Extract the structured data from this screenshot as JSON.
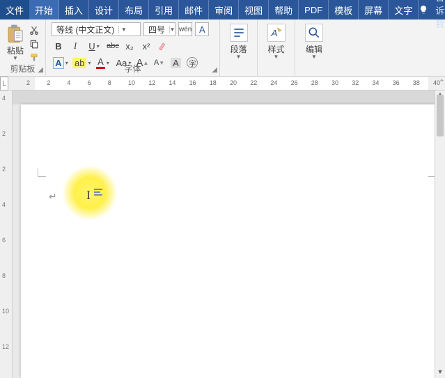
{
  "menu": {
    "file": "文件",
    "tabs": [
      "开始",
      "插入",
      "设计",
      "布局",
      "引用",
      "邮件",
      "审阅",
      "视图",
      "帮助",
      "PDF",
      "模板",
      "屏幕",
      "文字"
    ],
    "active_index": 0,
    "tell_me": "告诉我"
  },
  "clipboard": {
    "title": "剪贴板",
    "paste": "粘贴"
  },
  "font": {
    "title": "字体",
    "name": "等线 (中文正文)",
    "size": "四号",
    "pinyin": "wén",
    "char_border": "A",
    "bold": "B",
    "italic": "I",
    "underline": "U",
    "strike": "abc",
    "subscript": "x₂",
    "superscript": "x²",
    "text_effects": "A",
    "highlight": "ab",
    "font_color": "A",
    "change_case": "Aa",
    "grow": "A",
    "shrink": "A",
    "char_shading": "A",
    "enclose": "字"
  },
  "groups": {
    "paragraph": "段落",
    "styles": "样式",
    "editing": "编辑"
  },
  "ruler": {
    "L": "L",
    "h_ticks": [
      "2",
      "2",
      "4",
      "6",
      "8",
      "10",
      "12",
      "14",
      "16",
      "18",
      "20",
      "22",
      "24",
      "26",
      "28",
      "30",
      "32",
      "34",
      "36",
      "38",
      "40"
    ],
    "v_ticks": [
      "4",
      "2",
      "2",
      "4",
      "6",
      "8",
      "10",
      "12"
    ],
    "end": "⌃"
  }
}
